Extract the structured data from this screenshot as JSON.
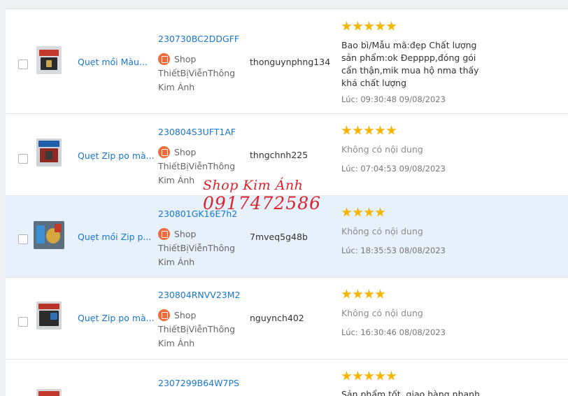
{
  "rows": [
    {
      "product": "Quẹt mồi Màu...",
      "order_code": "230730BC2DDGFF",
      "shop_word": "Shop",
      "shop_name": "ThiếtBịViễnThông Kim Ánh",
      "username": "thonguynphng134",
      "rating": 5,
      "review": "Bao bì/Mẫu mã:đẹp Chất lượng sản phẩm:ok Đepppp,đóng gói cẩn thận,mik mua hộ nma thấy khá chất lượng",
      "time": "Lúc: 09:30:48 09/08/2023",
      "highlighted": false
    },
    {
      "product": "Quẹt Zip po mà...",
      "order_code": "230804S3UFT1AF",
      "shop_word": "Shop",
      "shop_name": "ThiếtBịViễnThông Kim Ánh",
      "username": "thngchnh225",
      "rating": 5,
      "review": "Không có nội dung",
      "time": "Lúc: 07:04:53 09/08/2023",
      "highlighted": false
    },
    {
      "product": "Quẹt mồi Zip p...",
      "order_code": "230801GK16E7h2",
      "shop_word": "Shop",
      "shop_name": "ThiếtBịViễnThông Kim Ánh",
      "username": "7mveq5g48b",
      "rating": 4,
      "review": "Không có nội dung",
      "time": "Lúc: 18:35:53 08/08/2023",
      "highlighted": true
    },
    {
      "product": "Quẹt Zip po mà...",
      "order_code": "230804RNVV23M2",
      "shop_word": "Shop",
      "shop_name": "ThiếtBịViễnThông Kim Ánh",
      "username": "nguynch402",
      "rating": 4,
      "review": "Không có nội dung",
      "time": "Lúc: 16:30:46 08/08/2023",
      "highlighted": false
    },
    {
      "product": "",
      "order_code": "2307299B64W7PS",
      "shop_word": "",
      "shop_name": "",
      "username": "",
      "rating": 5,
      "review": "Sản phẩm tốt, giao hàng nhanh",
      "time": "",
      "highlighted": false
    }
  ],
  "watermark": {
    "line1": "Shop Kim Ánh",
    "line2": "0917472586"
  },
  "colors": {
    "link": "#1976d2",
    "star": "#f5b400",
    "highlight_row": "#e6f1fb",
    "shop_badge": "#ee6b3c",
    "watermark": "#d9232d"
  },
  "icons": {
    "star": "star-icon",
    "shop": "shop-bag-icon",
    "checkbox": "checkbox"
  }
}
